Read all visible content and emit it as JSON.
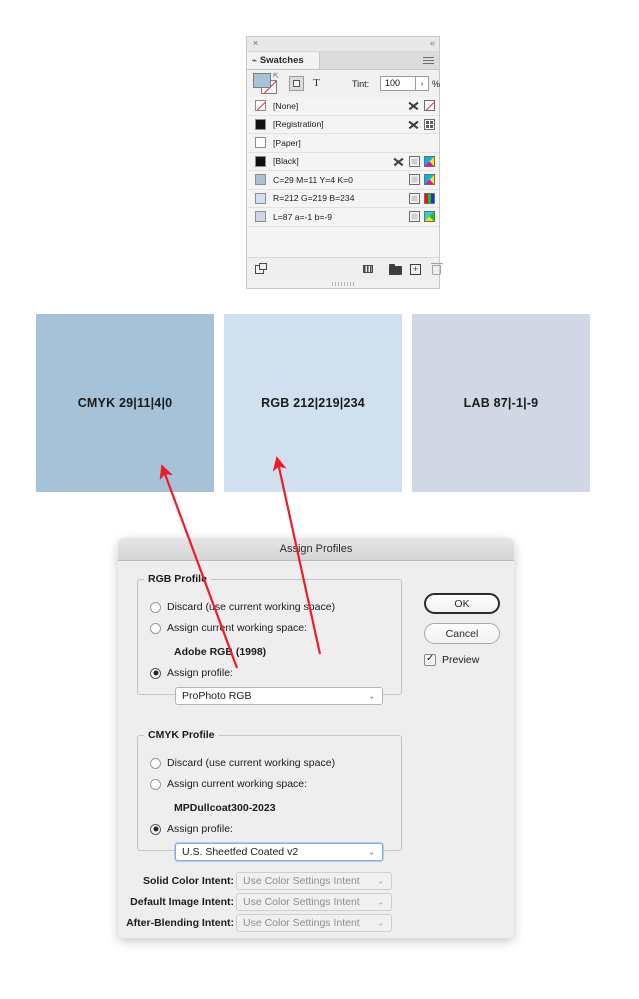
{
  "swatches_panel": {
    "title_bar": {
      "close_icon": "×",
      "collapse_icon": "«"
    },
    "tab": {
      "label": "Swatches",
      "diamond_icon": "⌁",
      "menu_icon": "panel-menu-icon"
    },
    "toolbar": {
      "fill_stroke_proxy": "fill-stroke-proxy",
      "fill_color": "#a6c2d9",
      "formatting_affects_container_label": "",
      "text_tool_label": "T",
      "tint_label": "Tint:",
      "tint_value": "100",
      "tint_stepper_icon": "›",
      "tint_unit": "%"
    },
    "rows": [
      {
        "name": "[None]",
        "chip": "none",
        "chip_color": "#ffffff",
        "icons": [
          "pin",
          "none-swatch"
        ]
      },
      {
        "name": "[Registration]",
        "chip": "solid",
        "chip_color": "#111111",
        "icons": [
          "pin",
          "registration"
        ]
      },
      {
        "name": "[Paper]",
        "chip": "solid",
        "chip_color": "#ffffff",
        "icons": []
      },
      {
        "name": "[Black]",
        "chip": "solid",
        "chip_color": "#111111",
        "icons": [
          "pin",
          "tint-box",
          "cmyk"
        ]
      },
      {
        "name": "C=29 M=11 Y=4 K=0",
        "chip": "solid",
        "chip_color": "#a6c2d9",
        "icons": [
          "tint-box",
          "cmyk"
        ]
      },
      {
        "name": "R=212 G=219 B=234",
        "chip": "solid",
        "chip_color": "#d0e0ef",
        "icons": [
          "tint-box",
          "rgb"
        ]
      },
      {
        "name": "L=87 a=-1 b=-9",
        "chip": "solid",
        "chip_color": "#d2d7e6",
        "icons": [
          "tint-box",
          "lab"
        ]
      }
    ],
    "footer_icons": [
      "show-color-libraries-icon",
      "color-group-icon",
      "new-color-group-folder-icon",
      "new-swatch-icon",
      "delete-swatch-icon"
    ]
  },
  "color_blocks": [
    {
      "label": "CMYK 29|11|4|0",
      "color": "#a6c2d9"
    },
    {
      "label": "RGB 212|219|234",
      "color": "#d0e0ef"
    },
    {
      "label": "LAB 87|-1|-9",
      "color": "#d2d7e6"
    }
  ],
  "annotations": {
    "arrow_color": "#ee1c25",
    "arrows": [
      {
        "name": "arrow-cmyk-dropdown-to-cmyk-block"
      },
      {
        "name": "arrow-rgb-dropdown-to-rgb-block"
      }
    ]
  },
  "dialog": {
    "title": "Assign Profiles",
    "buttons": {
      "ok": "OK",
      "cancel": "Cancel"
    },
    "preview": {
      "label": "Preview",
      "checked": true
    },
    "rgb_profile": {
      "legend": "RGB Profile",
      "options": [
        {
          "label": "Discard (use current working space)",
          "selected": false
        },
        {
          "label": "Assign current working space:",
          "selected": false
        },
        {
          "label": "Assign profile:",
          "selected": true
        }
      ],
      "working_space_value": "Adobe RGB (1998)",
      "profile_value": "ProPhoto RGB",
      "focused": false
    },
    "cmyk_profile": {
      "legend": "CMYK Profile",
      "options": [
        {
          "label": "Discard (use current working space)",
          "selected": false
        },
        {
          "label": "Assign current working space:",
          "selected": false
        },
        {
          "label": "Assign profile:",
          "selected": true
        }
      ],
      "working_space_value": "MPDullcoat300-2023",
      "profile_value": "U.S. Sheetfed Coated v2",
      "focused": true
    },
    "intents": [
      {
        "label": "Solid Color Intent:",
        "value": "Use Color Settings Intent",
        "disabled": true
      },
      {
        "label": "Default Image Intent:",
        "value": "Use Color Settings Intent",
        "disabled": true
      },
      {
        "label": "After-Blending Intent:",
        "value": "Use Color Settings Intent",
        "disabled": true
      }
    ]
  }
}
